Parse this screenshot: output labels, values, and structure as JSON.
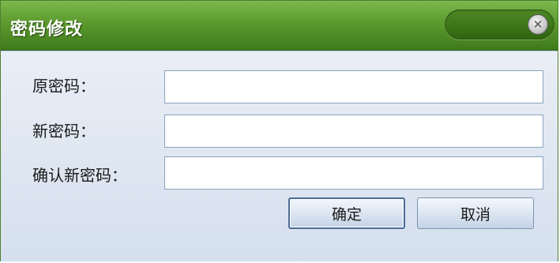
{
  "dialog": {
    "title": "密码修改",
    "close_icon": "close-icon",
    "close_glyph": "✕"
  },
  "form": {
    "old_password": {
      "label": "原密码：",
      "value": "",
      "placeholder": ""
    },
    "new_password": {
      "label": "新密码：",
      "value": "",
      "placeholder": ""
    },
    "confirm_password": {
      "label": "确认新密码：",
      "value": "",
      "placeholder": ""
    }
  },
  "buttons": {
    "ok_label": "确定",
    "cancel_label": "取消"
  },
  "colors": {
    "titlebar": "#5c9a2e",
    "body": "#dfe8f2"
  }
}
